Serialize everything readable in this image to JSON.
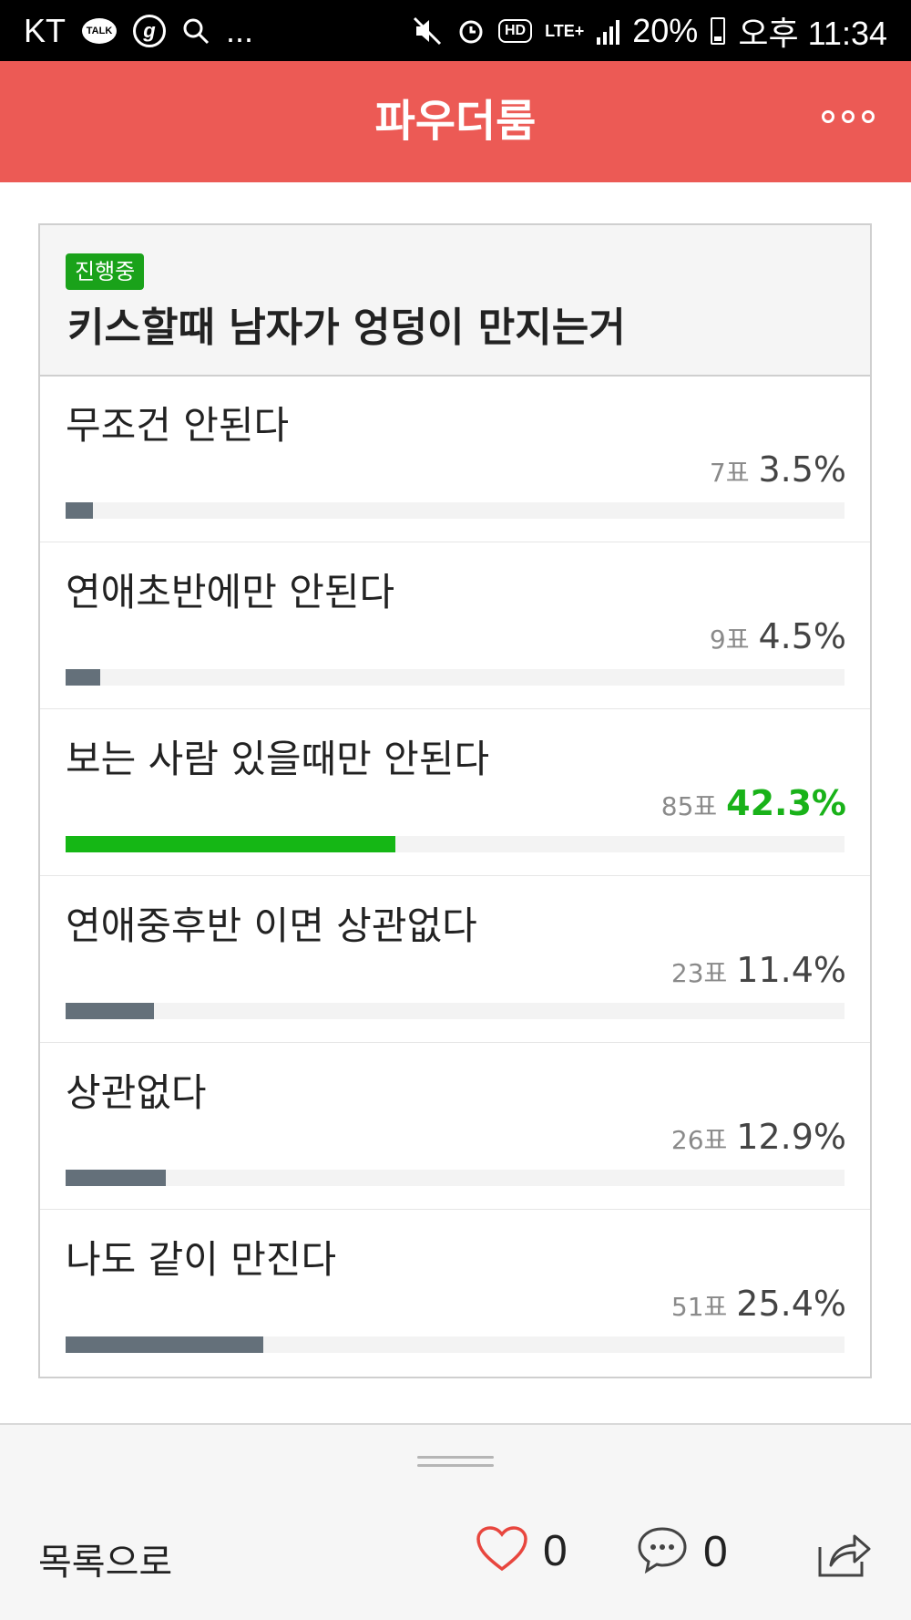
{
  "status_bar": {
    "carrier": "KT",
    "talk_icon_text": "TALK",
    "g_icon_text": "g",
    "more": "...",
    "hd": "HD",
    "lte": "LTE+",
    "battery": "20%",
    "time": "오후 11:34"
  },
  "header": {
    "title": "파우더룸"
  },
  "poll": {
    "status": "진행중",
    "title": "키스할때 남자가 엉덩이 만지는거",
    "options": [
      {
        "label": "무조건 안된다",
        "votes": "7표",
        "percent": "3.5%",
        "fraction": 0.035
      },
      {
        "label": "연애초반에만 안된다",
        "votes": "9표",
        "percent": "4.5%",
        "fraction": 0.045
      },
      {
        "label": "보는 사람 있을때만 안된다",
        "votes": "85표",
        "percent": "42.3%",
        "fraction": 0.423,
        "top": true
      },
      {
        "label": "연애중후반 이면 상관없다",
        "votes": "23표",
        "percent": "11.4%",
        "fraction": 0.114
      },
      {
        "label": "상관없다",
        "votes": "26표",
        "percent": "12.9%",
        "fraction": 0.129
      },
      {
        "label": "나도 같이 만진다",
        "votes": "51표",
        "percent": "25.4%",
        "fraction": 0.254
      }
    ],
    "colors": {
      "bar": "#64707a",
      "top_bar": "#15b715",
      "top_text": "#19b219",
      "badge": "#1aa21a"
    }
  },
  "bottom_bar": {
    "back_label": "목록으로",
    "like_count": "0",
    "comment_count": "0"
  },
  "theme": {
    "header_bg": "#ec5a55"
  }
}
